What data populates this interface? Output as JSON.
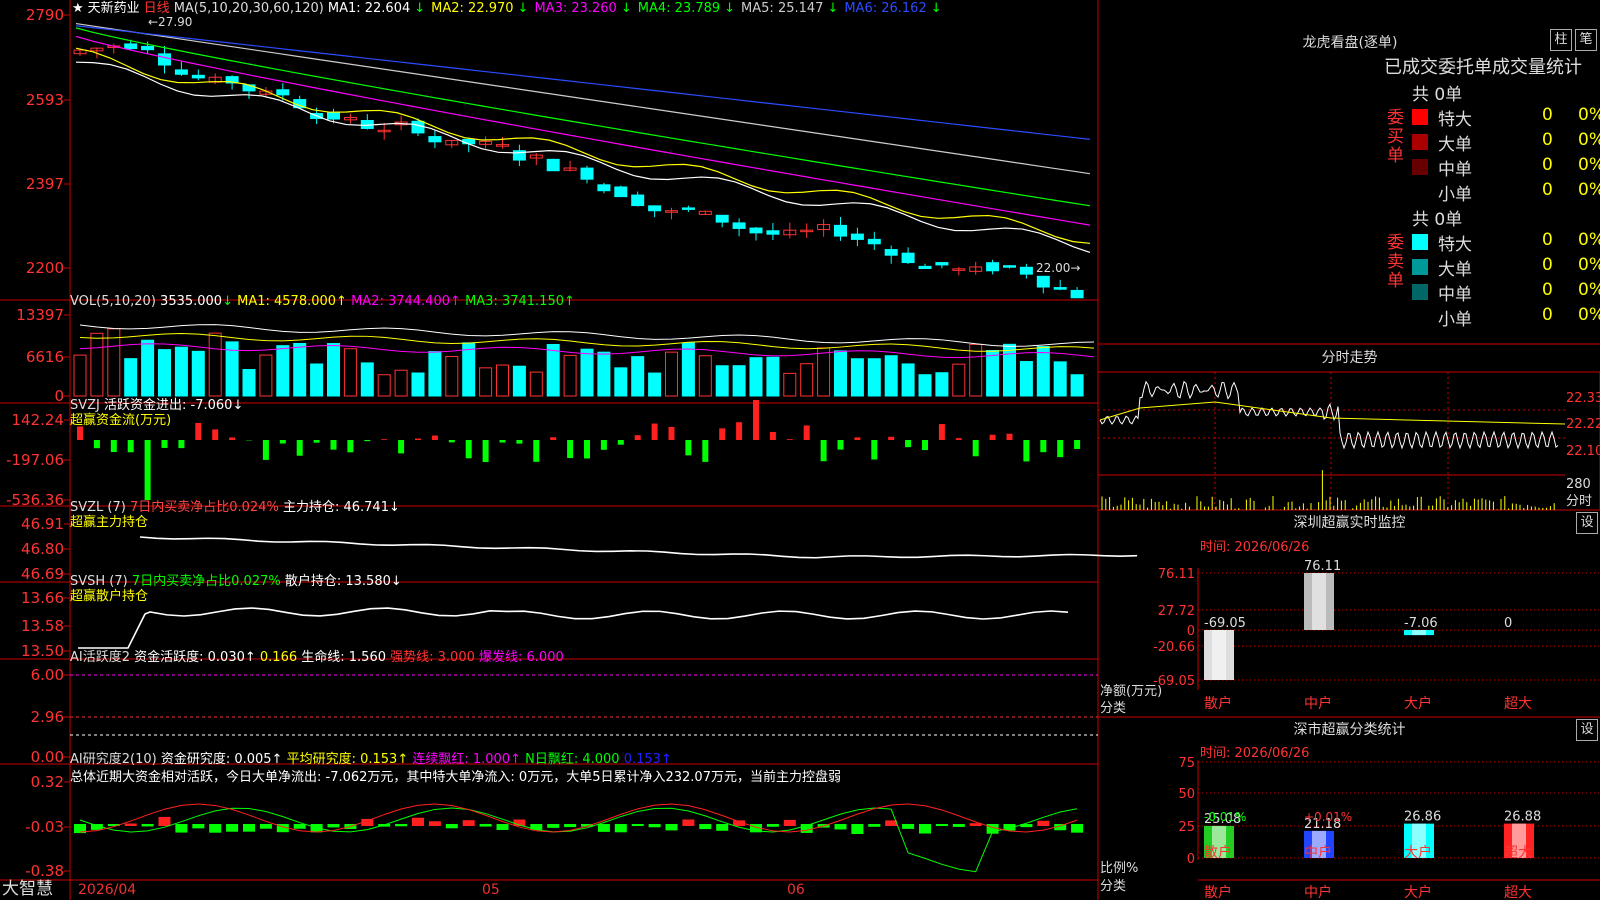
{
  "stock": {
    "name": "天新药业",
    "period": "日线",
    "star": "★"
  },
  "kline": {
    "ma_label": "MA(5,10,20,30,60,120)",
    "ma": [
      {
        "label": "MA1:",
        "value": "22.604",
        "arrow": "↓",
        "color": "#ffffff"
      },
      {
        "label": "MA2:",
        "value": "22.970",
        "arrow": "↓",
        "color": "#ffff00"
      },
      {
        "label": "MA3:",
        "value": "23.260",
        "arrow": "↓",
        "color": "#ff00ff"
      },
      {
        "label": "MA4:",
        "value": "23.789",
        "arrow": "↓",
        "color": "#00ff00"
      },
      {
        "label": "MA5:",
        "value": "25.147",
        "arrow": "↓",
        "color": "#cccccc"
      },
      {
        "label": "MA6:",
        "value": "26.162",
        "arrow": "↓",
        "color": "#2b4cff"
      }
    ],
    "yticks": [
      "2790",
      "2593",
      "2397",
      "2200"
    ],
    "high_label": "27.90",
    "low_label": "22.00"
  },
  "vol": {
    "label": "VOL(5,10,20)",
    "value": "3535.000",
    "arrow": "↓",
    "ma1": "MA1: 4578.000↑",
    "ma2": "MA2: 3744.400↑",
    "ma3": "MA3: 3741.150↑",
    "yticks": [
      "13397",
      "6616",
      "0"
    ]
  },
  "svzj": {
    "label": "SVZJ",
    "text": "活跃资金进出: -7.060↓",
    "sub": "超赢资金流(万元)",
    "yticks": [
      "142.24",
      "-197.06",
      "-536.36"
    ]
  },
  "svzl": {
    "label": "SVZL (7)",
    "ratio": "7日内买卖净占比0.024%",
    "hold": "主力持仓: 46.741↓",
    "sub": "超赢主力持仓",
    "yticks": [
      "46.91",
      "46.80",
      "46.69"
    ]
  },
  "svsh": {
    "label": "SVSH (7)",
    "ratio": "7日内买卖净占比0.027%",
    "hold": "散户持仓: 13.580↓",
    "sub": "超赢散户持仓",
    "yticks": [
      "13.66",
      "13.58",
      "13.50"
    ]
  },
  "ai_activity": {
    "label": "AI活跃度2",
    "a": "资金活跃度: 0.030↑",
    "b": "0.166",
    "c": "生命线: 1.560",
    "d": "强势线: 3.000",
    "e": "爆发线: 6.000",
    "yticks": [
      "6.00",
      "2.96",
      "0.00"
    ]
  },
  "ai_research": {
    "label": "AI研究度2(10)",
    "a": "资金研究度: 0.005↑",
    "b": "平均研究度: 0.153↑",
    "c": "连续飘红: 1.000↑",
    "d": "N日飘红: 4.000",
    "e": "0.153↑",
    "summary": "总体近期大资金相对活跃，今日大单净流出: -7.062万元，其中特大单净流入: 0万元，大单5日累计净入232.07万元，当前主力控盘弱",
    "yticks": [
      "0.32",
      "-0.03",
      "-0.38"
    ]
  },
  "footer": {
    "brand": "大智慧",
    "dates": [
      "2026/04",
      "05",
      "06"
    ]
  },
  "dragon": {
    "title": "龙虎看盘(逐单)",
    "btn_bar": "柱",
    "btn_pen": "笔",
    "header": "已成交委托单成交量统计",
    "buy": {
      "side": "委买单",
      "total": "共 0单",
      "rows": [
        {
          "name": "特大",
          "count": "0",
          "pct": "0%",
          "color": "#ff0000"
        },
        {
          "name": "大单",
          "count": "0",
          "pct": "0%",
          "color": "#aa0000"
        },
        {
          "name": "中单",
          "count": "0",
          "pct": "0%",
          "color": "#660000"
        },
        {
          "name": "小单",
          "count": "0",
          "pct": "0%",
          "color": "#000000"
        }
      ]
    },
    "sell": {
      "side": "委卖单",
      "total": "共 0单",
      "rows": [
        {
          "name": "特大",
          "count": "0",
          "pct": "0%",
          "color": "#00ffff"
        },
        {
          "name": "大单",
          "count": "0",
          "pct": "0%",
          "color": "#009999"
        },
        {
          "name": "中单",
          "count": "0",
          "pct": "0%",
          "color": "#006666"
        },
        {
          "name": "小单",
          "count": "0",
          "pct": "0%",
          "color": "#000000"
        }
      ]
    }
  },
  "intraday": {
    "title": "分时走势",
    "yticks": [
      "22.33",
      "22.22",
      "22.10"
    ],
    "vol_label": "280",
    "unit": "分时"
  },
  "monitor": {
    "title": "深圳超赢实时监控",
    "set": "设",
    "time": "时间: 2026/06/26",
    "yticks": [
      "76.11",
      "27.72",
      "0",
      "-20.66",
      "-69.05"
    ],
    "unit": "净额(万元)",
    "cat_label": "分类",
    "bars": [
      {
        "cat": "散户",
        "value": -69.05,
        "label": "-69.05"
      },
      {
        "cat": "中户",
        "value": 76.11,
        "label": "76.11"
      },
      {
        "cat": "大户",
        "value": -7.06,
        "label": "-7.06"
      },
      {
        "cat": "超大",
        "value": 0,
        "label": "0"
      }
    ]
  },
  "classify": {
    "title": "深市超赢分类统计",
    "set": "设",
    "time": "时间: 2026/06/26",
    "yticks": [
      "75",
      "50",
      "25",
      "0"
    ],
    "unit": "比例%",
    "cat_label": "分类",
    "bars": [
      {
        "cat": "散户",
        "value": 25.08,
        "label": "25.08",
        "change": "-0.01%"
      },
      {
        "cat": "中户",
        "value": 21.18,
        "label": "21.18",
        "change": "+0.01%"
      },
      {
        "cat": "大户",
        "value": 26.86,
        "label": "26.86",
        "change": ""
      },
      {
        "cat": "超大",
        "value": 26.88,
        "label": "26.88",
        "change": ""
      }
    ]
  }
}
